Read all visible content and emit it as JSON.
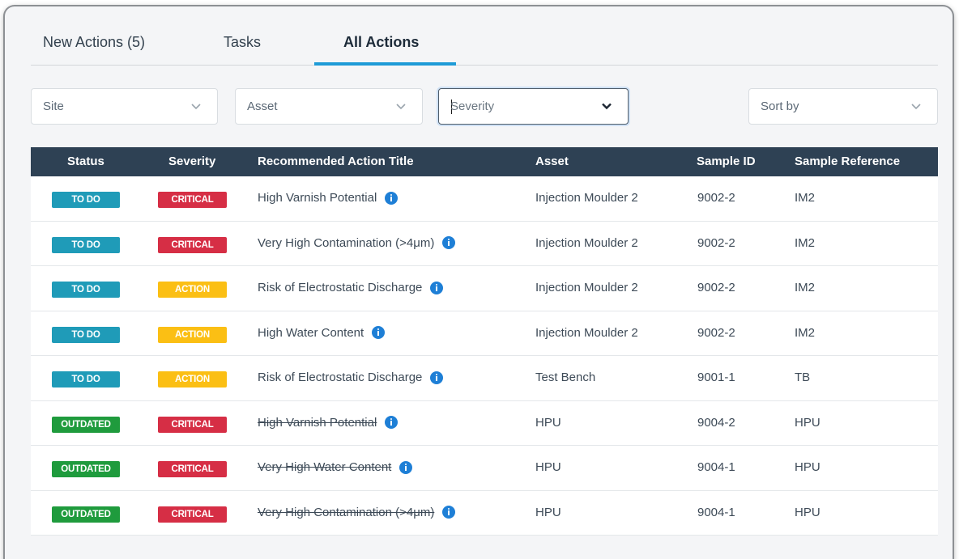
{
  "tabs": [
    {
      "label": "New Actions (5)"
    },
    {
      "label": "Tasks"
    },
    {
      "label": "All Actions"
    }
  ],
  "filters": {
    "site": "Site",
    "asset": "Asset",
    "severity": "Severity",
    "sort": "Sort by"
  },
  "table": {
    "headers": {
      "status": "Status",
      "severity": "Severity",
      "title": "Recommended Action Title",
      "asset": "Asset",
      "sample_id": "Sample ID",
      "sample_ref": "Sample Reference"
    },
    "rows": [
      {
        "status": "TO DO",
        "severity": "CRITICAL",
        "title": "High Varnish Potential",
        "asset": "Injection Moulder 2",
        "sample_id": "9002-2",
        "sample_ref": "IM2"
      },
      {
        "status": "TO DO",
        "severity": "CRITICAL",
        "title": "Very High Contamination (>4μm)",
        "asset": "Injection Moulder 2",
        "sample_id": "9002-2",
        "sample_ref": "IM2"
      },
      {
        "status": "TO DO",
        "severity": "ACTION",
        "title": "Risk of Electrostatic Discharge",
        "asset": "Injection Moulder 2",
        "sample_id": "9002-2",
        "sample_ref": "IM2"
      },
      {
        "status": "TO DO",
        "severity": "ACTION",
        "title": "High Water Content",
        "asset": "Injection Moulder 2",
        "sample_id": "9002-2",
        "sample_ref": "IM2"
      },
      {
        "status": "TO DO",
        "severity": "ACTION",
        "title": "Risk of Electrostatic Discharge",
        "asset": "Test Bench",
        "sample_id": "9001-1",
        "sample_ref": "TB"
      },
      {
        "status": "OUTDATED",
        "severity": "CRITICAL",
        "title": "High Varnish Potential",
        "asset": "HPU",
        "sample_id": "9004-2",
        "sample_ref": "HPU"
      },
      {
        "status": "OUTDATED",
        "severity": "CRITICAL",
        "title": "Very High Water Content",
        "asset": "HPU",
        "sample_id": "9004-1",
        "sample_ref": "HPU"
      },
      {
        "status": "OUTDATED",
        "severity": "CRITICAL",
        "title": "Very High Contamination (>4μm)",
        "asset": "HPU",
        "sample_id": "9004-1",
        "sample_ref": "HPU"
      }
    ]
  },
  "colors": {
    "TO DO": "#1f9bb8",
    "OUTDATED": "#1f9b3d",
    "CRITICAL": "#d62e45",
    "ACTION": "#fbbf14",
    "header_bg": "#2e4154",
    "tab_accent": "#1e9bd7",
    "info_icon": "#1e7fd6"
  },
  "icons": {
    "dropdown": "chevron-down-icon",
    "info": "info-icon"
  }
}
